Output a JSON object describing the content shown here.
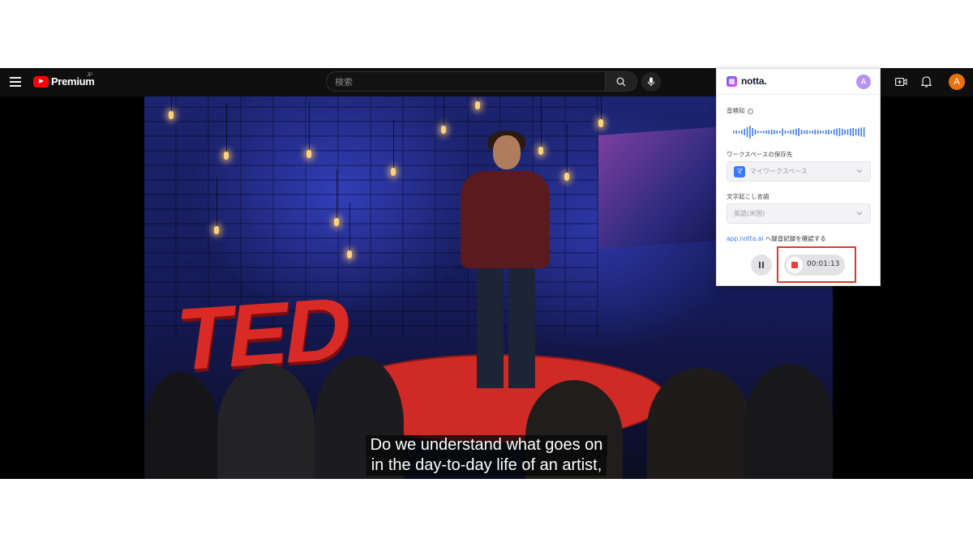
{
  "youtube": {
    "logo_text": "Premium",
    "logo_superscript": "JP",
    "search_placeholder": "検索",
    "avatar_letter": "A"
  },
  "video": {
    "stage_logo_text": "TED",
    "subtitle_line1": "Do we understand what goes on",
    "subtitle_line2": "in the day-to-day life of an artist,"
  },
  "notta": {
    "brand": "notta.",
    "avatar_letter": "A",
    "audio_detect_label": "音検知",
    "workspace_label": "ワークスペースの保存先",
    "workspace_badge": "マ",
    "workspace_value": "マイワークスペース",
    "language_label": "文字起こし言語",
    "language_value": "英語(米国)",
    "link_text": "app.notta.ai",
    "link_suffix": " へ録音記録を確認する",
    "timer": "00:01:13",
    "accent_color": "#3a7af2",
    "highlight_color": "#e2372a"
  }
}
